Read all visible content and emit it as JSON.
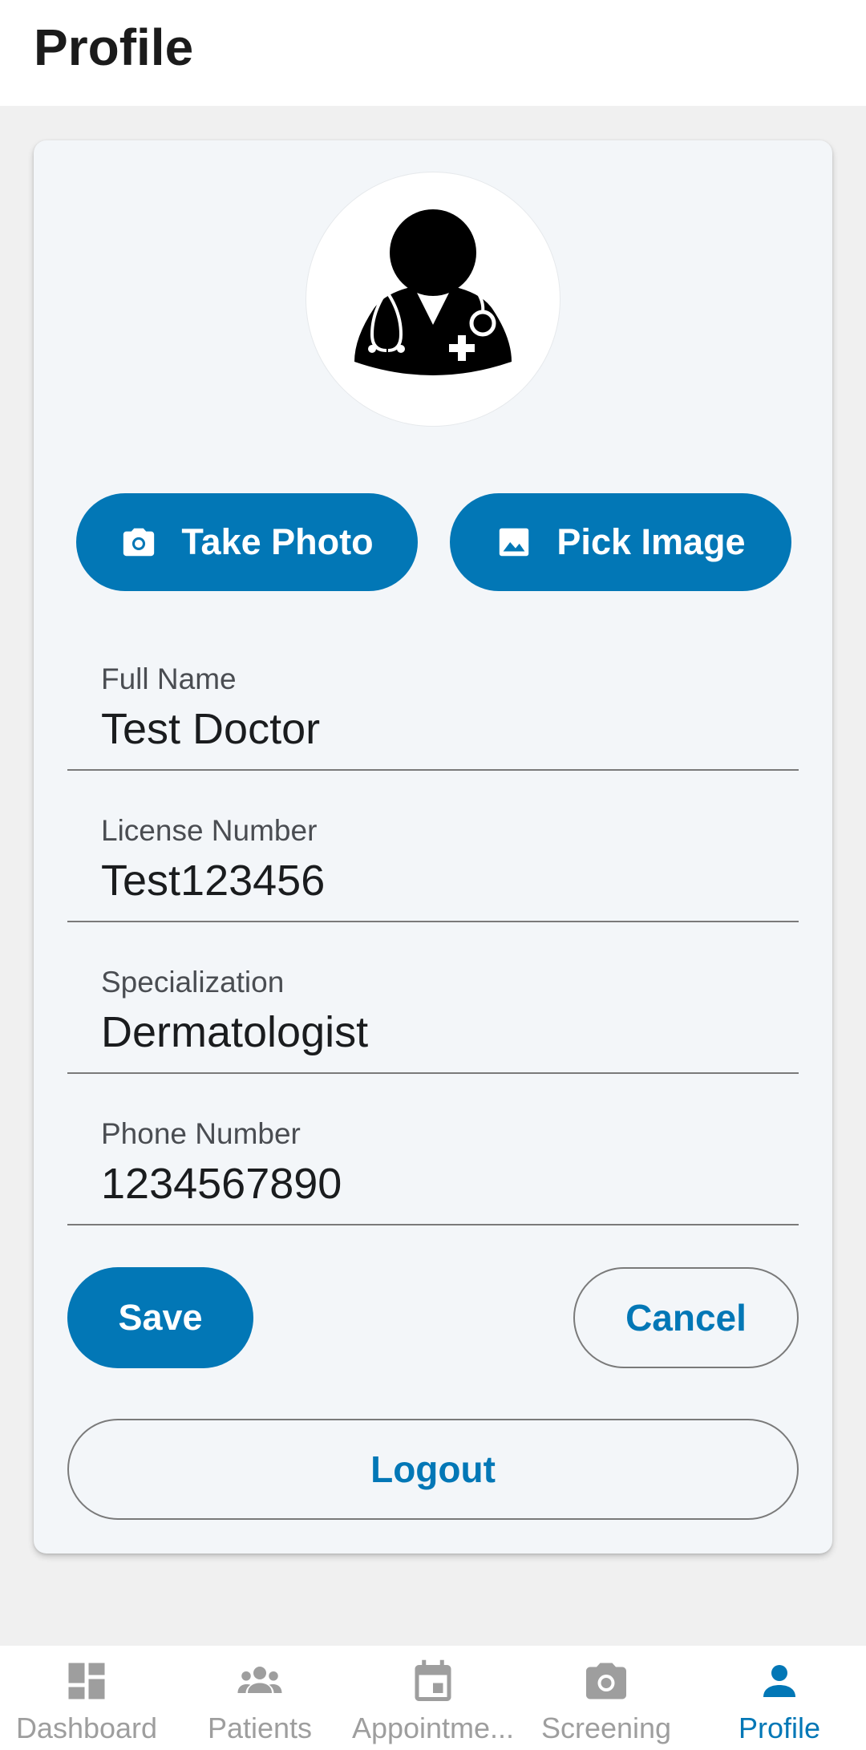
{
  "header": {
    "title": "Profile"
  },
  "photo_actions": {
    "take_photo_label": "Take Photo",
    "pick_image_label": "Pick Image"
  },
  "form": {
    "full_name": {
      "label": "Full Name",
      "value": "Test Doctor"
    },
    "license_number": {
      "label": "License Number",
      "value": "Test123456"
    },
    "specialization": {
      "label": "Specialization",
      "value": "Dermatologist"
    },
    "phone_number": {
      "label": "Phone Number",
      "value": "1234567890"
    }
  },
  "actions": {
    "save_label": "Save",
    "cancel_label": "Cancel",
    "logout_label": "Logout"
  },
  "bottom_nav": {
    "items": [
      {
        "label": "Dashboard",
        "icon": "dashboard-icon",
        "active": false
      },
      {
        "label": "Patients",
        "icon": "group-icon",
        "active": false
      },
      {
        "label": "Appointme...",
        "icon": "calendar-icon",
        "active": false
      },
      {
        "label": "Screening",
        "icon": "camera-icon",
        "active": false
      },
      {
        "label": "Profile",
        "icon": "person-icon",
        "active": true
      }
    ]
  },
  "colors": {
    "primary": "#0277b6",
    "card_background": "#f3f6f9",
    "page_background": "#f0f0f0",
    "inactive_nav": "#9e9e9e"
  }
}
